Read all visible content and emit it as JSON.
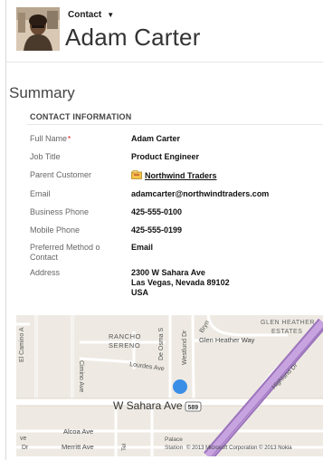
{
  "header": {
    "entity_label": "Contact",
    "caret": "▼",
    "record_name": "Adam Carter"
  },
  "summary": {
    "title": "Summary"
  },
  "contact_info": {
    "section_title": "CONTACT INFORMATION",
    "full_name": {
      "label": "Full Name",
      "required_marker": "*",
      "value": "Adam Carter"
    },
    "job_title": {
      "label": "Job Title",
      "value": "Product Engineer"
    },
    "parent_customer": {
      "label": "Parent Customer",
      "value": "Northwind Traders"
    },
    "email": {
      "label": "Email",
      "value": "adamcarter@northwindtraders.com"
    },
    "business_phone": {
      "label": "Business Phone",
      "value": "425-555-0100"
    },
    "mobile_phone": {
      "label": "Mobile Phone",
      "value": "425-555-0199"
    },
    "preferred_method": {
      "label_line1": "Preferred Method o",
      "label_line2": "Contact",
      "value": "Email"
    },
    "address": {
      "label": "Address",
      "line1": "2300 W Sahara Ave",
      "line2": "Las Vegas, Nevada 89102",
      "line3": "USA"
    }
  },
  "map": {
    "labels": {
      "el_camino": "El Camino A",
      "cimino": "Cimino Ave",
      "rancho": "RANCHO",
      "sereno": "SERENO",
      "de_osma": "De Osma S",
      "westlund": "Westlund Dr",
      "bryn": "Bryn",
      "glen_heather_estates_1": "GLEN HEATHER",
      "glen_heather_estates_2": "ESTATES",
      "glen_heather_way": "Glen Heather Way",
      "lourdes": "Lourdes Ave",
      "highland": "Highland Dr",
      "sahara": "W Sahara Ave",
      "route": "589",
      "alcoa": "Alcoa Ave",
      "merritt": "Merritt Ave",
      "palace_station_1": "Palace",
      "palace_station_2": "Station",
      "copyright": "© 2013 Microsoft Corporation   © 2013 Nokia",
      "left_edge": "ve",
      "left_edge2": "Dr",
      "tel": "Tel"
    },
    "colors": {
      "highway": "#b68fd0",
      "pin": "#3a8ee6",
      "road": "#ffffff"
    }
  }
}
